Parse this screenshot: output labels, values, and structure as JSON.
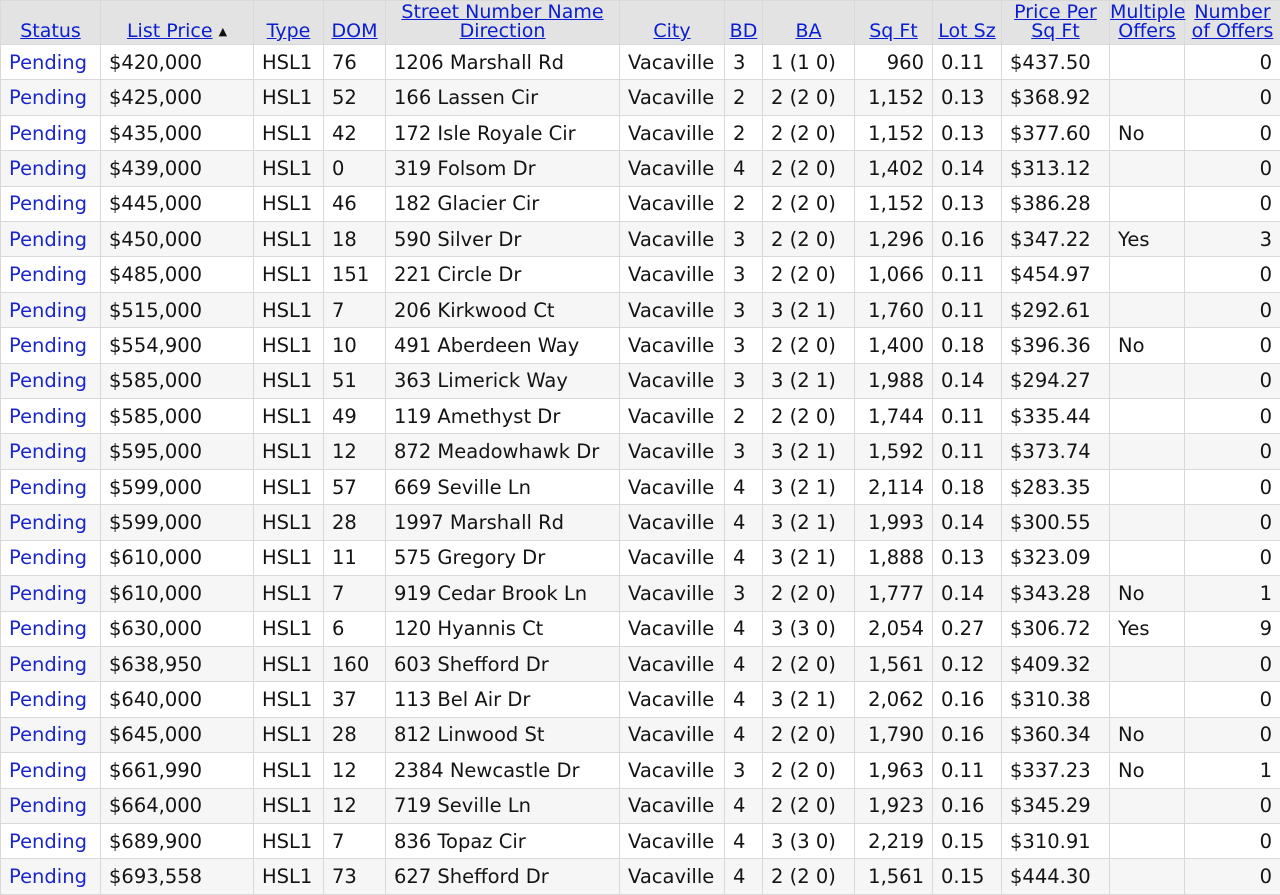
{
  "columns": [
    {
      "key": "status",
      "label": "Status"
    },
    {
      "key": "price",
      "label": "List Price",
      "sorted": "asc",
      "sort_icon": "sort-ascending-icon"
    },
    {
      "key": "type",
      "label": "Type"
    },
    {
      "key": "dom",
      "label": "DOM"
    },
    {
      "key": "address",
      "label": "Street Number Name Direction"
    },
    {
      "key": "city",
      "label": "City"
    },
    {
      "key": "bd",
      "label": "BD"
    },
    {
      "key": "ba",
      "label": "BA"
    },
    {
      "key": "sqft",
      "label": "Sq Ft"
    },
    {
      "key": "lot",
      "label": "Lot Sz"
    },
    {
      "key": "ppsf",
      "label": "Price Per Sq Ft"
    },
    {
      "key": "multi",
      "label": "Multiple Offers"
    },
    {
      "key": "offers",
      "label": "Number of Offers"
    }
  ],
  "rows": [
    [
      "Pending",
      "$420,000",
      "HSL1",
      "76",
      "1206 Marshall Rd",
      "Vacaville",
      "3",
      "1 (1 0)",
      "960",
      "0.11",
      "$437.50",
      "",
      "0"
    ],
    [
      "Pending",
      "$425,000",
      "HSL1",
      "52",
      "166 Lassen Cir",
      "Vacaville",
      "2",
      "2 (2 0)",
      "1,152",
      "0.13",
      "$368.92",
      "",
      "0"
    ],
    [
      "Pending",
      "$435,000",
      "HSL1",
      "42",
      "172 Isle Royale Cir",
      "Vacaville",
      "2",
      "2 (2 0)",
      "1,152",
      "0.13",
      "$377.60",
      "No",
      "0"
    ],
    [
      "Pending",
      "$439,000",
      "HSL1",
      "0",
      "319 Folsom Dr",
      "Vacaville",
      "4",
      "2 (2 0)",
      "1,402",
      "0.14",
      "$313.12",
      "",
      "0"
    ],
    [
      "Pending",
      "$445,000",
      "HSL1",
      "46",
      "182 Glacier Cir",
      "Vacaville",
      "2",
      "2 (2 0)",
      "1,152",
      "0.13",
      "$386.28",
      "",
      "0"
    ],
    [
      "Pending",
      "$450,000",
      "HSL1",
      "18",
      "590 Silver Dr",
      "Vacaville",
      "3",
      "2 (2 0)",
      "1,296",
      "0.16",
      "$347.22",
      "Yes",
      "3"
    ],
    [
      "Pending",
      "$485,000",
      "HSL1",
      "151",
      "221 Circle Dr",
      "Vacaville",
      "3",
      "2 (2 0)",
      "1,066",
      "0.11",
      "$454.97",
      "",
      "0"
    ],
    [
      "Pending",
      "$515,000",
      "HSL1",
      "7",
      "206 Kirkwood Ct",
      "Vacaville",
      "3",
      "3 (2 1)",
      "1,760",
      "0.11",
      "$292.61",
      "",
      "0"
    ],
    [
      "Pending",
      "$554,900",
      "HSL1",
      "10",
      "491 Aberdeen Way",
      "Vacaville",
      "3",
      "2 (2 0)",
      "1,400",
      "0.18",
      "$396.36",
      "No",
      "0"
    ],
    [
      "Pending",
      "$585,000",
      "HSL1",
      "51",
      "363 Limerick Way",
      "Vacaville",
      "3",
      "3 (2 1)",
      "1,988",
      "0.14",
      "$294.27",
      "",
      "0"
    ],
    [
      "Pending",
      "$585,000",
      "HSL1",
      "49",
      "119 Amethyst Dr",
      "Vacaville",
      "2",
      "2 (2 0)",
      "1,744",
      "0.11",
      "$335.44",
      "",
      "0"
    ],
    [
      "Pending",
      "$595,000",
      "HSL1",
      "12",
      "872 Meadowhawk Dr",
      "Vacaville",
      "3",
      "3 (2 1)",
      "1,592",
      "0.11",
      "$373.74",
      "",
      "0"
    ],
    [
      "Pending",
      "$599,000",
      "HSL1",
      "57",
      "669 Seville Ln",
      "Vacaville",
      "4",
      "3 (2 1)",
      "2,114",
      "0.18",
      "$283.35",
      "",
      "0"
    ],
    [
      "Pending",
      "$599,000",
      "HSL1",
      "28",
      "1997 Marshall Rd",
      "Vacaville",
      "4",
      "3 (2 1)",
      "1,993",
      "0.14",
      "$300.55",
      "",
      "0"
    ],
    [
      "Pending",
      "$610,000",
      "HSL1",
      "11",
      "575 Gregory Dr",
      "Vacaville",
      "4",
      "3 (2 1)",
      "1,888",
      "0.13",
      "$323.09",
      "",
      "0"
    ],
    [
      "Pending",
      "$610,000",
      "HSL1",
      "7",
      "919 Cedar Brook Ln",
      "Vacaville",
      "3",
      "2 (2 0)",
      "1,777",
      "0.14",
      "$343.28",
      "No",
      "1"
    ],
    [
      "Pending",
      "$630,000",
      "HSL1",
      "6",
      "120 Hyannis Ct",
      "Vacaville",
      "4",
      "3 (3 0)",
      "2,054",
      "0.27",
      "$306.72",
      "Yes",
      "9"
    ],
    [
      "Pending",
      "$638,950",
      "HSL1",
      "160",
      "603 Shefford Dr",
      "Vacaville",
      "4",
      "2 (2 0)",
      "1,561",
      "0.12",
      "$409.32",
      "",
      "0"
    ],
    [
      "Pending",
      "$640,000",
      "HSL1",
      "37",
      "113 Bel Air Dr",
      "Vacaville",
      "4",
      "3 (2 1)",
      "2,062",
      "0.16",
      "$310.38",
      "",
      "0"
    ],
    [
      "Pending",
      "$645,000",
      "HSL1",
      "28",
      "812 Linwood St",
      "Vacaville",
      "4",
      "2 (2 0)",
      "1,790",
      "0.16",
      "$360.34",
      "No",
      "0"
    ],
    [
      "Pending",
      "$661,990",
      "HSL1",
      "12",
      "2384 Newcastle Dr",
      "Vacaville",
      "3",
      "2 (2 0)",
      "1,963",
      "0.11",
      "$337.23",
      "No",
      "1"
    ],
    [
      "Pending",
      "$664,000",
      "HSL1",
      "12",
      "719 Seville Ln",
      "Vacaville",
      "4",
      "2 (2 0)",
      "1,923",
      "0.16",
      "$345.29",
      "",
      "0"
    ],
    [
      "Pending",
      "$689,900",
      "HSL1",
      "7",
      "836 Topaz Cir",
      "Vacaville",
      "4",
      "3 (3 0)",
      "2,219",
      "0.15",
      "$310.91",
      "",
      "0"
    ],
    [
      "Pending",
      "$693,558",
      "HSL1",
      "73",
      "627 Shefford Dr",
      "Vacaville",
      "4",
      "2 (2 0)",
      "1,561",
      "0.15",
      "$444.30",
      "",
      "0"
    ]
  ]
}
